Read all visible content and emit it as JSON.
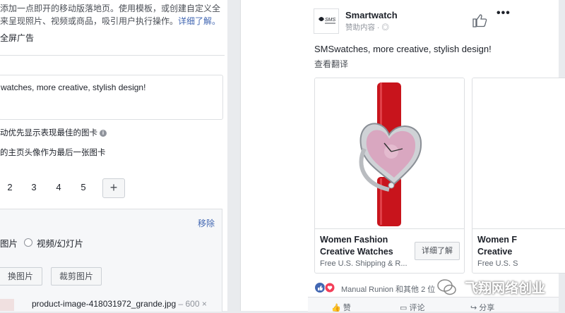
{
  "left": {
    "description_line1": "添加一点即开的移动版落地页。使用模板，或创建自定义全",
    "description_line2": "来呈现照片、视频或商品，吸引用户执行操作。",
    "description_link": "详细了解。",
    "fullscreen_label": "全屏广告",
    "text_value": "watches, more creative, stylish design!",
    "option_best_card": "动优先显示表现最佳的图卡",
    "option_profile_card": "的主页头像作为最后一张图卡",
    "card_numbers": [
      "2",
      "3",
      "4",
      "5"
    ],
    "add_label": "+",
    "remove_label": "移除",
    "media_option_image": "图片",
    "media_option_video": "视频/幻灯片",
    "change_image_label": "换图片",
    "crop_image_label": "裁剪图片",
    "file_name": "product-image-418031972_grande.jpg",
    "file_size": "– 600 ×"
  },
  "preview": {
    "page_name": "Smartwatch",
    "logo_text": "SMS",
    "sponsored": "赞助内容 · ",
    "more_label": "•••",
    "message": "SMSwatches, more creative, stylish design!",
    "translate": "查看翻译",
    "cards": [
      {
        "title_line1": "Women Fashion",
        "title_line2": "Creative Watches",
        "subtitle": "Free U.S. Shipping & R...",
        "cta": "详细了解"
      },
      {
        "title_line1": "Women F",
        "title_line2": "Creative",
        "subtitle": "Free U.S. S"
      }
    ],
    "reactions": "Manual Runion 和其他 2 位",
    "actions": {
      "like": "赞",
      "comment": "评论",
      "share": "分享"
    }
  },
  "watermark": "飞翔网络创业",
  "colors": {
    "link": "#4267b2",
    "strap": "#c8141c",
    "dial": "#d9a7c0"
  }
}
